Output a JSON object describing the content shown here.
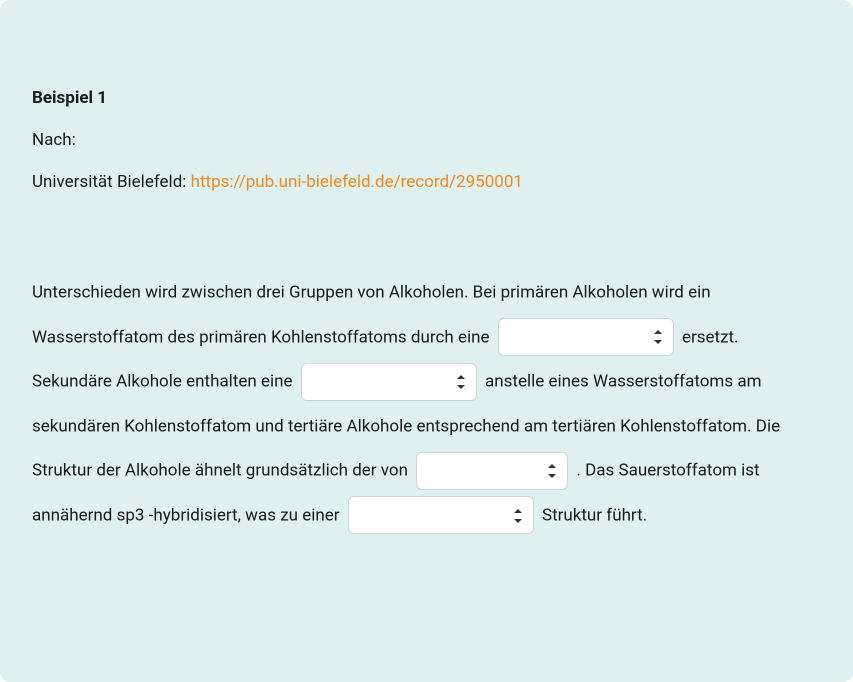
{
  "heading": "Beispiel 1",
  "after_label": "Nach:",
  "citation": {
    "prefix": "Universität Bielefeld: ",
    "link_text": "https://pub.uni-bielefeld.de/record/2950001",
    "link_href": "https://pub.uni-bielefeld.de/record/2950001"
  },
  "body": {
    "seg1": "Unterschieden wird zwischen drei Gruppen von Alkoholen. Bei primären Alkoholen wird ein Wasserstoffatom des primären Kohlenstoffatoms durch eine ",
    "seg2": " ersetzt. Sekundäre Alkohole enthalten eine ",
    "seg3": " anstelle eines Wasserstoffatoms am sekundären Kohlenstoffatom und tertiäre Alkohole entsprechend am tertiären Kohlenstoffatom. Die Struktur der Alkohole ähnelt grundsätzlich der von ",
    "seg4": " . Das Sauerstoffatom ist annähernd sp3 -hybridisiert, was zu einer ",
    "seg5": " Struktur führt."
  },
  "selects": {
    "s1": {
      "value": ""
    },
    "s2": {
      "value": ""
    },
    "s3": {
      "value": ""
    },
    "s4": {
      "value": ""
    }
  }
}
